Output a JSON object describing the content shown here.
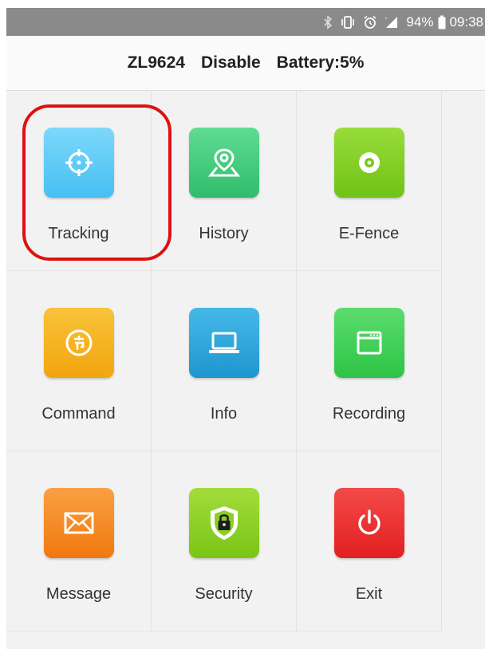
{
  "status_bar": {
    "battery_pct": "94%",
    "time": "09:38",
    "icons": [
      "bluetooth-icon",
      "vibrate-icon",
      "alarm-icon",
      "signal-icon",
      "battery-icon"
    ]
  },
  "header": {
    "device_id": "ZL9624",
    "status": "Disable",
    "battery": "Battery:5%"
  },
  "tiles": [
    {
      "label": "Tracking",
      "icon": "crosshair-icon",
      "color": "#56c8f5"
    },
    {
      "label": "History",
      "icon": "map-pin-icon",
      "color": "#3ec97a"
    },
    {
      "label": "E-Fence",
      "icon": "disc-icon",
      "color": "#7ecb1f"
    },
    {
      "label": "Command",
      "icon": "command-coin-icon",
      "color": "#f5b21c"
    },
    {
      "label": "Info",
      "icon": "laptop-icon",
      "color": "#2aa6da"
    },
    {
      "label": "Recording",
      "icon": "recorder-icon",
      "color": "#3ccf55"
    },
    {
      "label": "Message",
      "icon": "envelope-icon",
      "color": "#f58a22"
    },
    {
      "label": "Security",
      "icon": "shield-lock-icon",
      "color": "#8ccf22"
    },
    {
      "label": "Exit",
      "icon": "power-icon",
      "color": "#ea2a2a"
    }
  ],
  "highlight_color": "#e01010"
}
